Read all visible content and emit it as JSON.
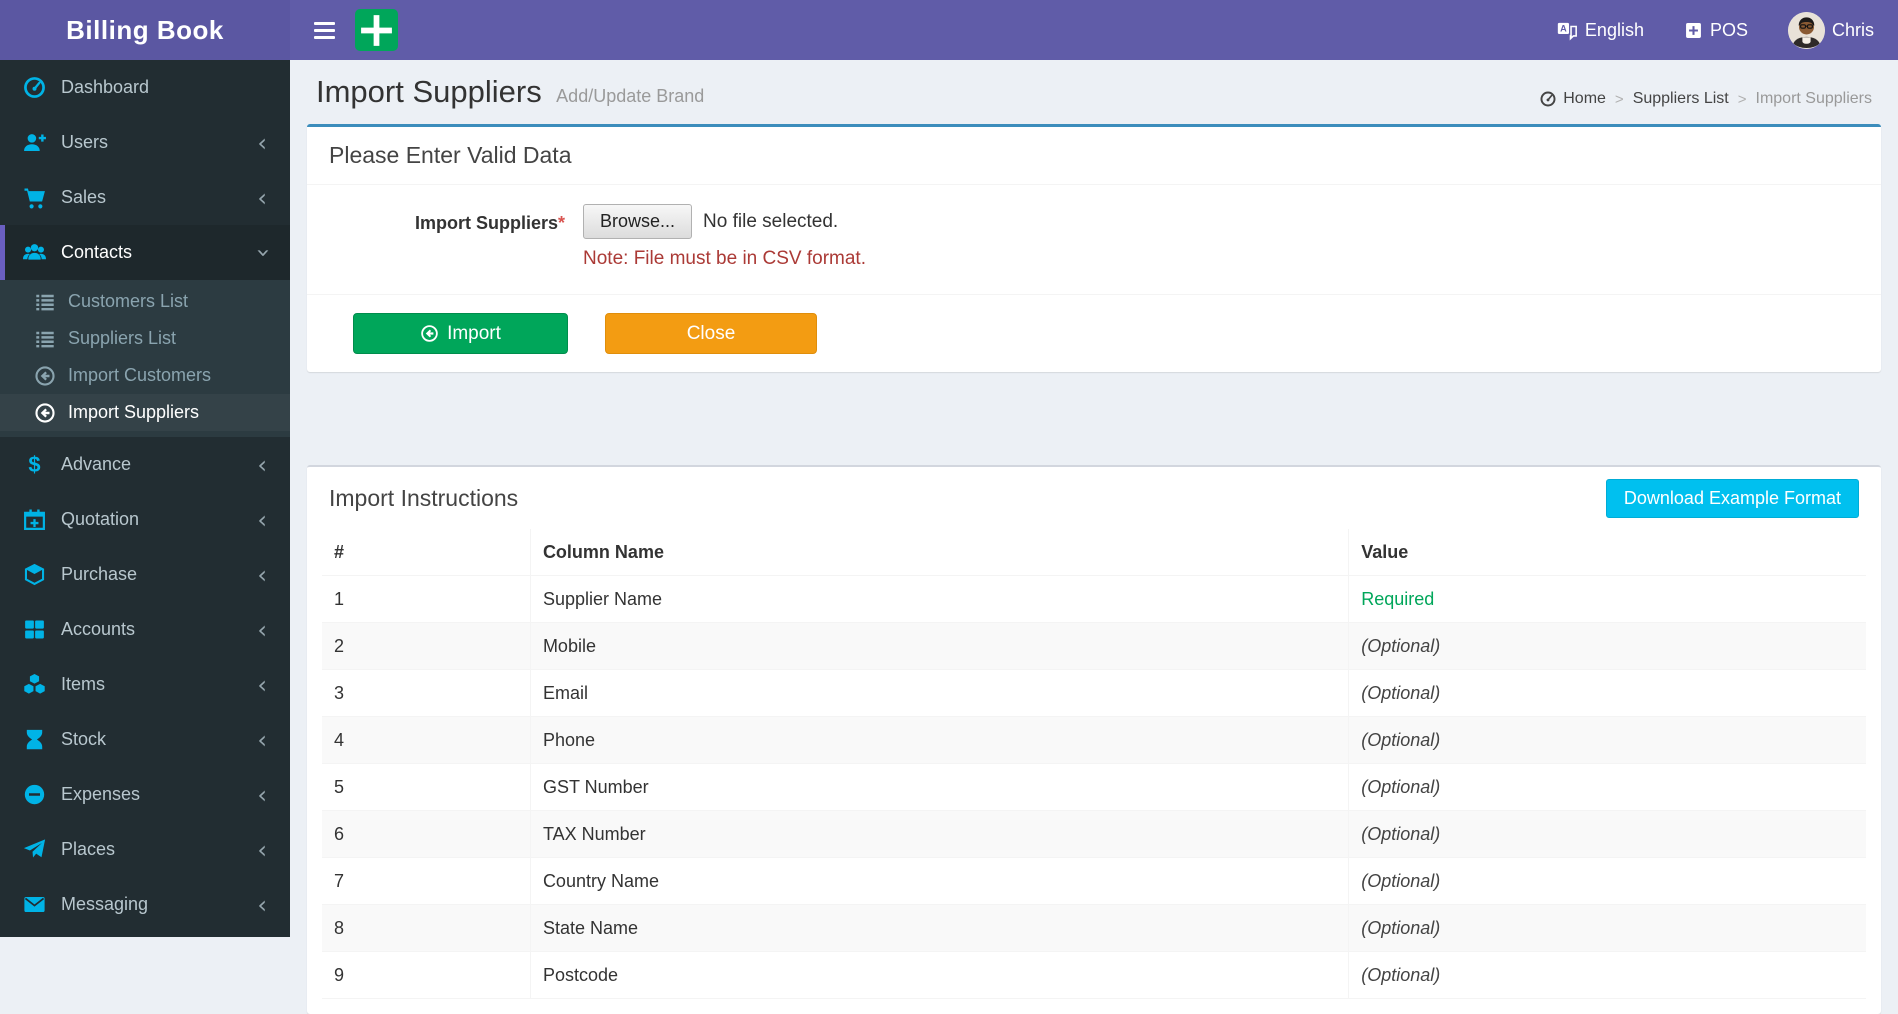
{
  "colors": {
    "header_purple": "#605ca8",
    "sidebar_dark": "#222d32",
    "icon_blue": "#00b3e6",
    "success_green": "#00a65a",
    "warning_orange": "#f39c12",
    "info_cyan": "#00c0ef",
    "primary_blue": "#3c8dbc",
    "note_red": "#ab3a36",
    "required_green": "#00a65a"
  },
  "header": {
    "brand": "Billing Book",
    "language_label": "English",
    "pos_label": "POS",
    "user_name": "Chris"
  },
  "sidebar": {
    "items": [
      {
        "label": "Dashboard",
        "icon": "dashboard",
        "chevron": false
      },
      {
        "label": "Users",
        "icon": "user-plus",
        "chevron": true
      },
      {
        "label": "Sales",
        "icon": "cart",
        "chevron": true
      },
      {
        "label": "Contacts",
        "icon": "users",
        "chevron": true,
        "active": true,
        "expanded": true,
        "children": [
          {
            "label": "Customers List",
            "icon": "list"
          },
          {
            "label": "Suppliers List",
            "icon": "list"
          },
          {
            "label": "Import Customers",
            "icon": "arrow-circle-left"
          },
          {
            "label": "Import Suppliers",
            "icon": "arrow-circle-left",
            "active": true
          }
        ]
      },
      {
        "label": "Advance",
        "icon": "dollar",
        "chevron": true
      },
      {
        "label": "Quotation",
        "icon": "calendar-plus",
        "chevron": true
      },
      {
        "label": "Purchase",
        "icon": "cube",
        "chevron": true
      },
      {
        "label": "Accounts",
        "icon": "grid",
        "chevron": true
      },
      {
        "label": "Items",
        "icon": "cubes",
        "chevron": true
      },
      {
        "label": "Stock",
        "icon": "hourglass",
        "chevron": true
      },
      {
        "label": "Expenses",
        "icon": "minus-circle",
        "chevron": true
      },
      {
        "label": "Places",
        "icon": "paper-plane",
        "chevron": true
      },
      {
        "label": "Messaging",
        "icon": "envelope",
        "chevron": true
      }
    ]
  },
  "page": {
    "title": "Import Suppliers",
    "subtitle": "Add/Update Brand",
    "breadcrumb": [
      {
        "label": "Home",
        "icon": "dashboard"
      },
      {
        "label": "Suppliers List"
      },
      {
        "label": "Import Suppliers",
        "current": true
      }
    ]
  },
  "form_box": {
    "heading": "Please Enter Valid Data",
    "field_label": "Import Suppliers",
    "required_mark": "*",
    "browse_label": "Browse...",
    "no_file_text": "No file selected.",
    "note": "Note: File must be in CSV format.",
    "import_label": "Import",
    "close_label": "Close"
  },
  "instructions_box": {
    "heading": "Import Instructions",
    "download_label": "Download Example Format",
    "table": {
      "headers": [
        "#",
        "Column Name",
        "Value"
      ],
      "rows": [
        {
          "num": "1",
          "column": "Supplier Name",
          "value": "Required",
          "required": true
        },
        {
          "num": "2",
          "column": "Mobile",
          "value": "(Optional)",
          "required": false
        },
        {
          "num": "3",
          "column": "Email",
          "value": "(Optional)",
          "required": false
        },
        {
          "num": "4",
          "column": "Phone",
          "value": "(Optional)",
          "required": false
        },
        {
          "num": "5",
          "column": "GST Number",
          "value": "(Optional)",
          "required": false
        },
        {
          "num": "6",
          "column": "TAX Number",
          "value": "(Optional)",
          "required": false
        },
        {
          "num": "7",
          "column": "Country Name",
          "value": "(Optional)",
          "required": false
        },
        {
          "num": "8",
          "column": "State Name",
          "value": "(Optional)",
          "required": false
        },
        {
          "num": "9",
          "column": "Postcode",
          "value": "(Optional)",
          "required": false
        }
      ]
    }
  }
}
